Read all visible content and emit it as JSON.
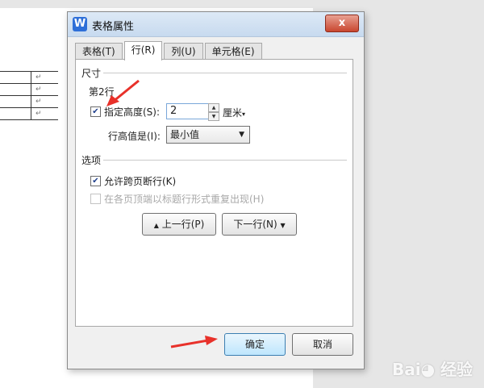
{
  "dialog": {
    "title": "表格属性",
    "close_label": "x",
    "tabs": [
      {
        "label": "表格(T)",
        "active": false
      },
      {
        "label": "行(R)",
        "active": true
      },
      {
        "label": "列(U)",
        "active": false
      },
      {
        "label": "单元格(E)",
        "active": false
      }
    ],
    "size_section": {
      "label": "尺寸",
      "row_label": "第2行",
      "specify_height": {
        "label": "指定高度(S):",
        "checked": true
      },
      "height_value": "2",
      "unit": "厘米",
      "row_height_label": "行高值是(I):",
      "row_height_selected": "最小值"
    },
    "options_section": {
      "label": "选项",
      "allow_break": {
        "label": "允许跨页断行(K)",
        "checked": true
      },
      "repeat_header": {
        "label": "在各页顶端以标题行形式重复出现(H)",
        "checked": false,
        "enabled": false
      }
    },
    "prev_row_label": "上一行(P)",
    "next_row_label": "下一行(N)",
    "ok_label": "确定",
    "cancel_label": "取消"
  },
  "document": {
    "paragraph_mark": "↵"
  },
  "annotation_color": "#e8312a",
  "icons": [
    "app-icon",
    "close-icon",
    "spin-up-icon",
    "spin-down-icon",
    "dropdown-arrow-icon",
    "up-arrow-icon",
    "down-arrow-icon",
    "check-icon"
  ]
}
